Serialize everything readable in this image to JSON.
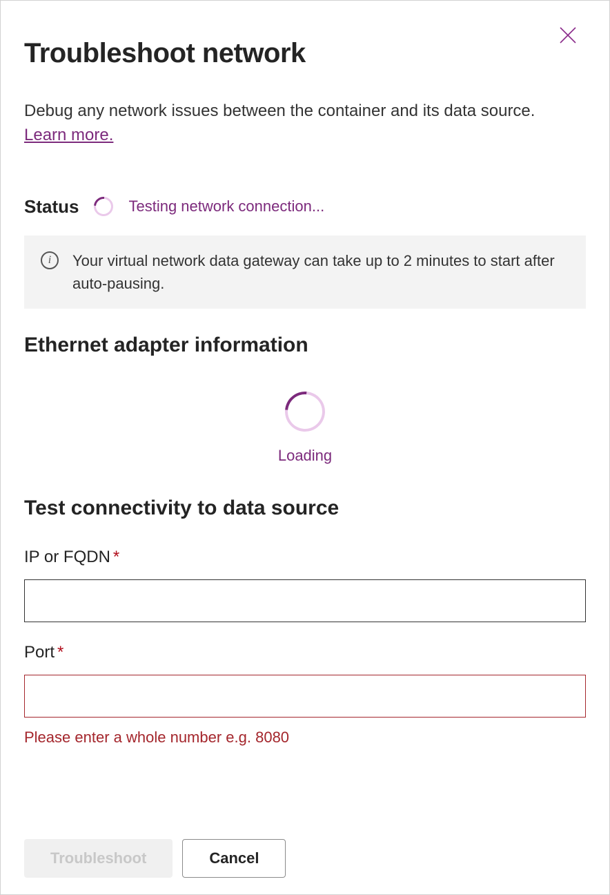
{
  "header": {
    "title": "Troubleshoot network",
    "intro_text": "Debug any network issues between the container and its data source. ",
    "learn_more_label": "Learn more."
  },
  "status": {
    "label": "Status",
    "message": "Testing network connection..."
  },
  "info_banner": {
    "text": "Your virtual network data gateway can take up to 2 minutes to start after auto-pausing."
  },
  "ethernet": {
    "heading": "Ethernet adapter information",
    "loading_label": "Loading"
  },
  "connectivity": {
    "heading": "Test connectivity to data source",
    "ip_label": "IP or FQDN",
    "ip_value": "",
    "port_label": "Port",
    "port_value": "",
    "port_error": "Please enter a whole number e.g. 8080",
    "required_marker": "*"
  },
  "footer": {
    "troubleshoot_label": "Troubleshoot",
    "cancel_label": "Cancel"
  }
}
